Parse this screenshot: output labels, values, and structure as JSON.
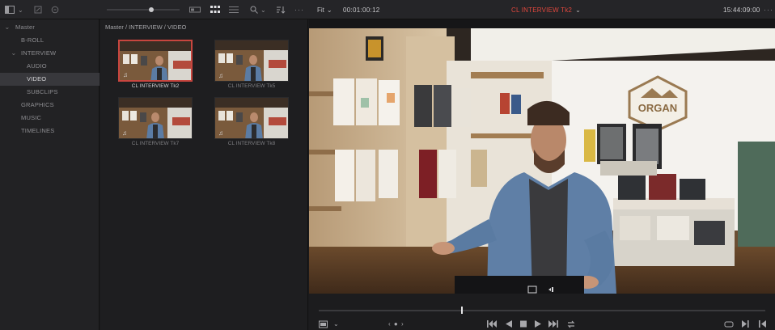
{
  "toolbar": {
    "fit_label": "Fit",
    "timecode": "00:01:00:12",
    "clip_title": "CL INTERVIEW Tk2",
    "time_of_day": "15:44:09:00",
    "more_label": "···",
    "tc_icon": "⌄",
    "title_dropdown": "⌄"
  },
  "sidebar": {
    "items": [
      {
        "label": "Master"
      },
      {
        "label": "B-ROLL"
      },
      {
        "label": "INTERVIEW"
      },
      {
        "label": "AUDIO"
      },
      {
        "label": "VIDEO"
      },
      {
        "label": "SUBCLIPS"
      },
      {
        "label": "GRAPHICS"
      },
      {
        "label": "MUSIC"
      },
      {
        "label": "TIMELINES"
      }
    ],
    "chevron_down": "⌄",
    "chevron_down2": "⌄"
  },
  "bin": {
    "breadcrumb": "Master / INTERVIEW / VIDEO",
    "clips": [
      {
        "name": "CL INTERVIEW Tk2"
      },
      {
        "name": "CL INTERVIEW Tk5"
      },
      {
        "name": "CL INTERVIEW Tk7"
      },
      {
        "name": "CL INTERVIEW Tk8"
      }
    ],
    "audio_glyph": "♫"
  },
  "viewer": {
    "sign_text": "ORGAN"
  },
  "transport": {
    "jog": "‹ ● ›",
    "first": "⏮",
    "prev": "◀",
    "stop": "■",
    "play": "▶",
    "last": "⏭",
    "loop": "↻",
    "match": "⇄",
    "next_edit": "▶|",
    "prev_edit": "|◀"
  }
}
